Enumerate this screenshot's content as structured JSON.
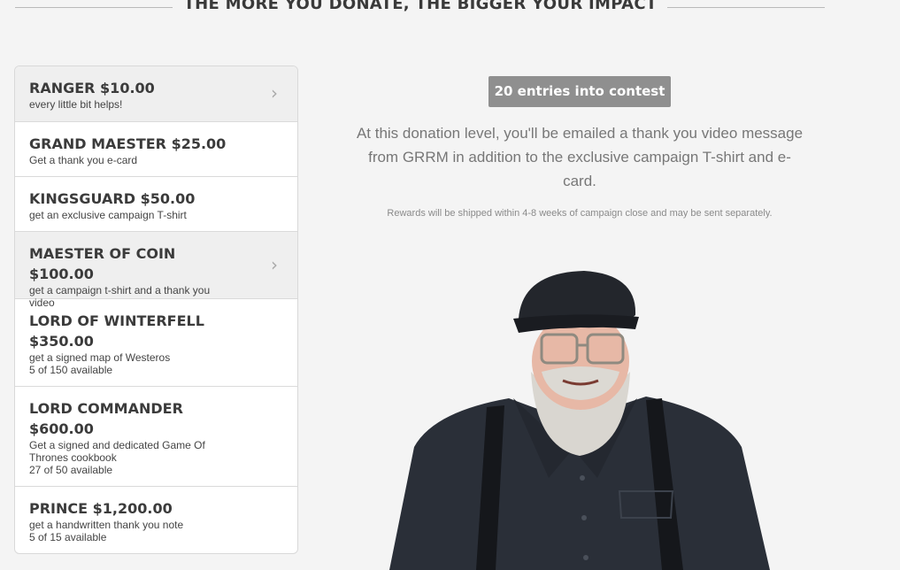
{
  "heading": "THE MORE YOU DONATE, THE BIGGER YOUR IMPACT",
  "tiers": [
    {
      "title": "RANGER $10.00",
      "desc": "every little bit helps!",
      "avail": ""
    },
    {
      "title": "GRAND MAESTER $25.00",
      "desc": "Get a thank you e-card",
      "avail": ""
    },
    {
      "title": "KINGSGUARD $50.00",
      "desc": "get an exclusive campaign T-shirt",
      "avail": ""
    },
    {
      "title": "MAESTER OF COIN $100.00",
      "desc": "get a campaign t-shirt and a thank you video",
      "avail": ""
    },
    {
      "title": "LORD OF WINTERFELL $350.00",
      "desc": "get a signed map of Westeros",
      "avail": "5 of 150 available"
    },
    {
      "title": "LORD COMMANDER $600.00",
      "desc": "Get a signed and dedicated Game Of Thrones cookbook",
      "avail": "27 of 50 available"
    },
    {
      "title": "PRINCE $1,200.00",
      "desc": "get a handwritten thank you note",
      "avail": "5 of 15 available"
    }
  ],
  "reward": {
    "entries_badge": "20 entries into contest",
    "description": "At this donation level, you'll be emailed a thank you video message from GRRM in addition to the exclusive campaign T-shirt and e-card.",
    "shipping_note": "Rewards will be shipped within 4-8 weeks of campaign close and may be sent separately."
  },
  "icons": {
    "chevron": "chevron-right-icon",
    "portrait": "person-photo"
  },
  "colors": {
    "badge_bg": "#8f8f8f",
    "page_bg": "#f4f4f4",
    "shirt": "#2a2f38",
    "cap": "#23262c",
    "beard": "#d9d6d0"
  }
}
